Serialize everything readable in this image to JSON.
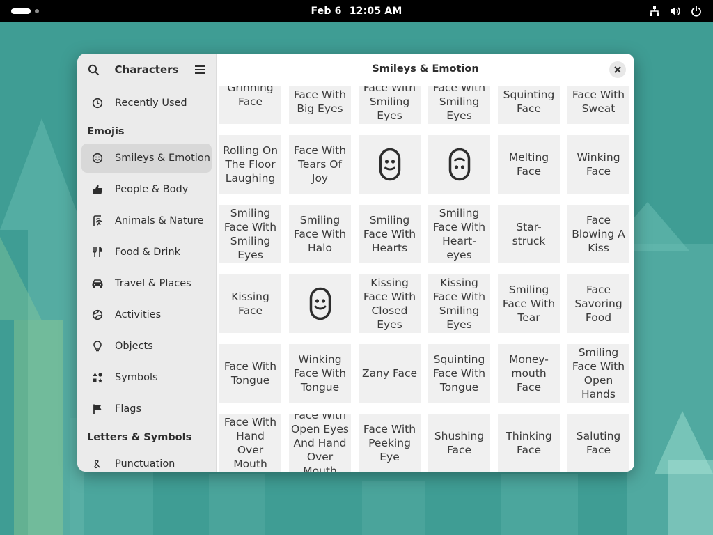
{
  "topbar": {
    "date": "Feb 6",
    "time": "12:05 AM"
  },
  "app": {
    "title": "Characters",
    "section_title": "Smileys & Emotion"
  },
  "sidebar": {
    "recent": "Recently Used",
    "emojis_header": "Emojis",
    "categories": [
      {
        "label": "Smileys & Emotion",
        "icon": "smiley-icon"
      },
      {
        "label": "People & Body",
        "icon": "thumbs-up-icon"
      },
      {
        "label": "Animals & Nature",
        "icon": "animals-icon"
      },
      {
        "label": "Food & Drink",
        "icon": "cutlery-icon"
      },
      {
        "label": "Travel & Places",
        "icon": "car-icon"
      },
      {
        "label": "Activities",
        "icon": "ball-icon"
      },
      {
        "label": "Objects",
        "icon": "lightbulb-icon"
      },
      {
        "label": "Symbols",
        "icon": "symbols-icon"
      },
      {
        "label": "Flags",
        "icon": "flag-icon"
      }
    ],
    "letters_header": "Letters & Symbols",
    "punctuation": "Punctuation"
  },
  "grid": {
    "items": [
      "Grinning Face",
      "Grinning Face With Big Eyes",
      "Grinning Face With Smiling Eyes",
      "Beaming Face With Smiling Eyes",
      "Grinning Squinting Face",
      "Grinning Face With Sweat",
      "Rolling On The Floor Laughing",
      "Face With Tears Of Joy",
      "",
      "",
      "Melting Face",
      "Winking Face",
      "Smiling Face With Smiling Eyes",
      "Smiling Face With Halo",
      "Smiling Face With Hearts",
      "Smiling Face With Heart-eyes",
      "Star-struck",
      "Face Blowing A Kiss",
      "Kissing Face",
      "",
      "Kissing Face With Closed Eyes",
      "Kissing Face With Smiling Eyes",
      "Smiling Face With Tear",
      "Face Savoring Food",
      "Face With Tongue",
      "Winking Face With Tongue",
      "Zany Face",
      "Squinting Face With Tongue",
      "Money-mouth Face",
      "Smiling Face With Open Hands",
      "Face With Hand Over Mouth",
      "Face With Open Eyes And Hand Over Mouth",
      "Face With Peeking Eye",
      "Shushing Face",
      "Thinking Face",
      "Saluting Face"
    ],
    "glyph_icons": {
      "8": "slight-smile-glyph-icon",
      "9": "upside-down-glyph-icon",
      "19": "smile-glyph-icon"
    }
  },
  "colors": {
    "desktop": "#3f9d94",
    "sidebar": "#ebebeb",
    "active_item": "#d8d8d8",
    "cell": "#f0f0f0"
  }
}
